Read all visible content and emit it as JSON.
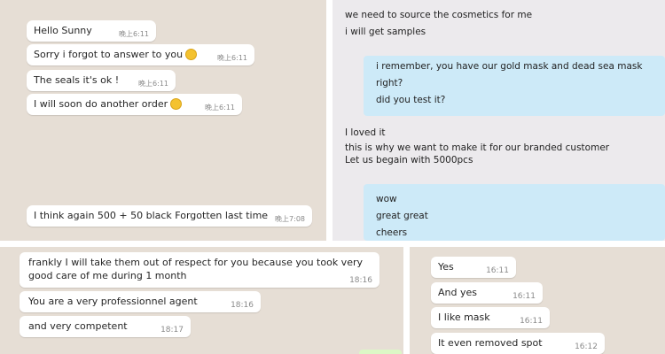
{
  "panel1": {
    "messages": [
      {
        "text": "Hello Sunny",
        "time": "晚上6:11"
      },
      {
        "text": "Sorry i forgot to answer to you",
        "time": "晚上6:11",
        "emoji": "disappointed-face"
      },
      {
        "text": "The seals it's ok !",
        "time": "晚上6:11"
      },
      {
        "text": "I will soon do another order",
        "time": "晚上6:11",
        "emoji": "hugging-face"
      },
      {
        "text": "I think again 500 + 50 black Forgotten last time",
        "time": "晚上7:08"
      }
    ]
  },
  "panel2": {
    "incoming1": {
      "line1": "we need to source the cosmetics for me",
      "line2": "i will get samples"
    },
    "outgoing1": {
      "line1": "i remember, you have our gold mask and dead sea mask",
      "line2": "right?",
      "line3": "did you test it?"
    },
    "incoming2": {
      "line1": "I loved it",
      "line2": "this is why we want to make it for our branded customer",
      "line3": "Let us begain with 5000pcs"
    },
    "outgoing2": {
      "line1": "wow",
      "line2": "great great",
      "line3": "cheers"
    }
  },
  "panel3": {
    "messages": [
      {
        "line1": "frankly I will take them out of respect for you because you took very",
        "line2": "good care of me during 1 month",
        "time": "18:16"
      },
      {
        "text": "You are a very professionnel agent",
        "time": "18:16"
      },
      {
        "text": "and very competent",
        "time": "18:17"
      }
    ]
  },
  "panel4": {
    "messages": [
      {
        "text": "Yes",
        "time": "16:11"
      },
      {
        "text": "And yes",
        "time": "16:11"
      },
      {
        "text": "I like mask",
        "time": "16:11"
      },
      {
        "text": "It even removed spot",
        "time": "16:12"
      }
    ]
  },
  "colors": {
    "chat_bg": "#e6ded5",
    "gray_bg": "#eceaed",
    "sent_blue": "#cdeaf8",
    "green_hint": "#dcf8c6"
  }
}
